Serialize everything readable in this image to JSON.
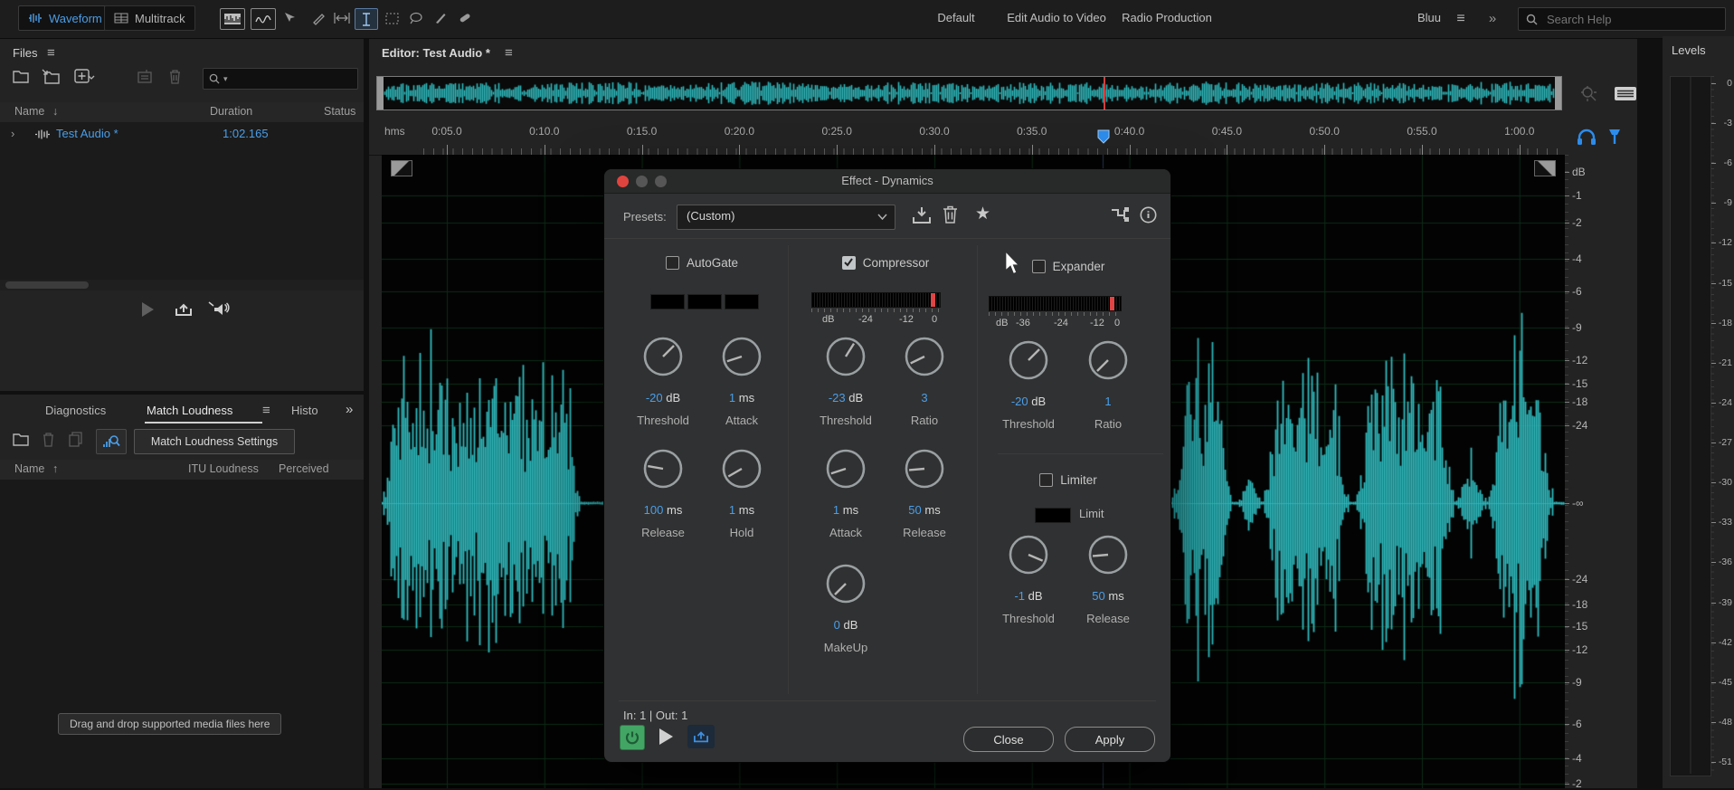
{
  "colors": {
    "accent_blue": "#4a9ee8",
    "teal_waveform": "#2fbabd",
    "playhead_red": "#cf3f3f",
    "meter_red": "#e04545",
    "power_green": "#43a564"
  },
  "icons": {
    "menu": "≡",
    "overflow": "»",
    "chevron_expand": "›",
    "sort_desc": "↓",
    "sort_asc": "↑",
    "star": "★"
  },
  "app": {
    "topbar": {
      "tabs": [
        {
          "label": "Waveform"
        },
        {
          "label": "Multitrack"
        }
      ],
      "workspaces": [
        "Default",
        "Edit Audio to Video",
        "Radio Production",
        "Bluu"
      ],
      "active_workspace": "Bluu",
      "search_placeholder": "Search Help"
    }
  },
  "files_panel": {
    "title": "Files",
    "columns": [
      "Name",
      "Duration",
      "Status"
    ],
    "rows": [
      {
        "name": "Test Audio *",
        "duration": "1:02.165"
      }
    ]
  },
  "loudness_panel": {
    "tabs": [
      "Diagnostics",
      "Match Loudness",
      "Histo"
    ],
    "active_tab": "Match Loudness",
    "settings_button": "Match Loudness Settings",
    "columns": [
      "Name",
      "ITU Loudness",
      "Perceived"
    ],
    "dropzone": "Drag and drop supported media files here"
  },
  "editor": {
    "title": "Editor: Test Audio *",
    "time_unit": "hms",
    "ticks": [
      "0:05.0",
      "0:10.0",
      "0:15.0",
      "0:20.0",
      "0:25.0",
      "0:30.0",
      "0:35.0",
      "0:40.0",
      "0:45.0",
      "0:50.0",
      "0:55.0",
      "1:00.0"
    ],
    "amp_ruler": [
      "dB",
      "-1",
      "-2",
      "-4",
      "-6",
      "-9",
      "-12",
      "-15",
      "-18",
      "-24",
      "-∞",
      "-24",
      "-18",
      "-15",
      "-12",
      "-9",
      "-6",
      "-4",
      "-2"
    ]
  },
  "levels_panel": {
    "title": "Levels",
    "scale": [
      "0",
      "-3",
      "-6",
      "-9",
      "-12",
      "-15",
      "-18",
      "-21",
      "-24",
      "-27",
      "-30",
      "-33",
      "-36",
      "-39",
      "-42",
      "-45",
      "-48",
      "-51"
    ]
  },
  "dialog": {
    "title": "Effect - Dynamics",
    "presets_label": "Presets:",
    "preset_value": "(Custom)",
    "io_status": "In: 1 | Out: 1",
    "buttons": {
      "close": "Close",
      "apply": "Apply"
    },
    "sections": {
      "autogate": {
        "label": "AutoGate",
        "checked": false,
        "knobs": [
          {
            "value": "-20",
            "unit": "dB",
            "label": "Threshold"
          },
          {
            "value": "1",
            "unit": "ms",
            "label": "Attack"
          },
          {
            "value": "100",
            "unit": "ms",
            "label": "Release"
          },
          {
            "value": "1",
            "unit": "ms",
            "label": "Hold"
          }
        ]
      },
      "compressor": {
        "label": "Compressor",
        "checked": true,
        "meter_scale": [
          "dB",
          "-24",
          "-12",
          "0"
        ],
        "knobs": [
          {
            "value": "-23",
            "unit": "dB",
            "label": "Threshold"
          },
          {
            "value": "3",
            "unit": "",
            "label": "Ratio"
          },
          {
            "value": "1",
            "unit": "ms",
            "label": "Attack"
          },
          {
            "value": "50",
            "unit": "ms",
            "label": "Release"
          },
          {
            "value": "0",
            "unit": "dB",
            "label": "MakeUp"
          }
        ]
      },
      "expander": {
        "label": "Expander",
        "checked": false,
        "meter_scale": [
          "dB",
          "-36",
          "-24",
          "-12",
          "0"
        ],
        "knobs": [
          {
            "value": "-20",
            "unit": "dB",
            "label": "Threshold"
          },
          {
            "value": "1",
            "unit": "",
            "label": "Ratio"
          }
        ]
      },
      "limiter": {
        "label": "Limiter",
        "checked": false,
        "led_label": "Limit",
        "knobs": [
          {
            "value": "-1",
            "unit": "dB",
            "label": "Threshold"
          },
          {
            "value": "50",
            "unit": "ms",
            "label": "Release"
          }
        ]
      }
    }
  }
}
